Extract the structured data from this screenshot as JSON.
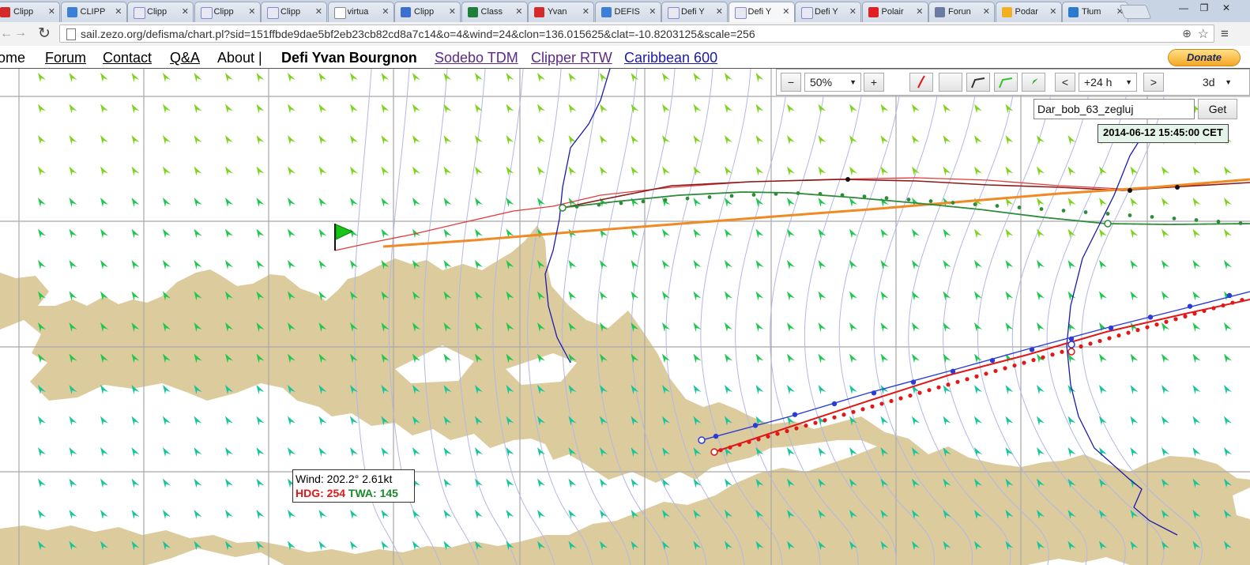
{
  "browser": {
    "tabs": [
      {
        "label": "Clipp",
        "icon": "v-red"
      },
      {
        "label": "CLIPP",
        "icon": "globe"
      },
      {
        "label": "Clipp",
        "icon": "chart"
      },
      {
        "label": "Clipp",
        "icon": "chart"
      },
      {
        "label": "Clipp",
        "icon": "chart"
      },
      {
        "label": "virtua",
        "icon": "page"
      },
      {
        "label": "Clipp",
        "icon": "cloud"
      },
      {
        "label": "Class",
        "icon": "excel"
      },
      {
        "label": "Yvan",
        "icon": "v-red"
      },
      {
        "label": "DEFIS",
        "icon": "globe"
      },
      {
        "label": "Defi Y",
        "icon": "chart"
      },
      {
        "label": "Defi Y",
        "icon": "chart"
      },
      {
        "label": "Defi Y",
        "icon": "chart"
      },
      {
        "label": "Polair",
        "icon": "sail"
      },
      {
        "label": "Forun",
        "icon": "forum"
      },
      {
        "label": "Podar",
        "icon": "coin"
      },
      {
        "label": "Tłum",
        "icon": "translate"
      }
    ],
    "active_tab": 11,
    "url": "sail.zezo.org/defisma/chart.pl?sid=151ffbde9dae5bf2eb23cb82cd8a7c14&o=4&wind=24&clon=136.015625&clat=-10.8203125&scale=256"
  },
  "nav": {
    "home": "ome",
    "forum": "Forum",
    "contact": "Contact",
    "qa": "Q&A",
    "about": "About |",
    "current_race": "Defi Yvan Bourgnon",
    "links": [
      "Sodebo TDM",
      "Clipper RTW",
      "Caribbean 600"
    ],
    "donate": "Donate"
  },
  "controls": {
    "zoom_out": "−",
    "zoom_value": "50%",
    "zoom_in": "+",
    "time_prev": "<",
    "time_value": "+24 h",
    "time_next": ">",
    "range_value": "3d",
    "boat_name": "Dar_bob_63_zegluj",
    "get_button": "Get",
    "datetime": "2014-06-12 15:45:00 CET"
  },
  "wind_tooltip": {
    "wind": "Wind: 202.2° 2.61kt",
    "hdg_label": "HDG: 254",
    "twa_label": "TWA: 145"
  },
  "colors": {
    "land": "#dccb9c",
    "grid": "#a8a8a8",
    "isochrone": "#b3b7e6",
    "wind_arrow_lime": "#7fd320",
    "wind_arrow_green": "#1fc74f",
    "wind_arrow_teal": "#18c49a",
    "route_red": "#e33b3b",
    "route_darkred": "#8b1a1a",
    "route_orange": "#f08a24",
    "route_green": "#2e8b3a",
    "course_blue": "#2a3cd8",
    "course_red": "#e01818",
    "coast_track_blue": "#1a1ab0",
    "flag_green": "#18c418"
  }
}
